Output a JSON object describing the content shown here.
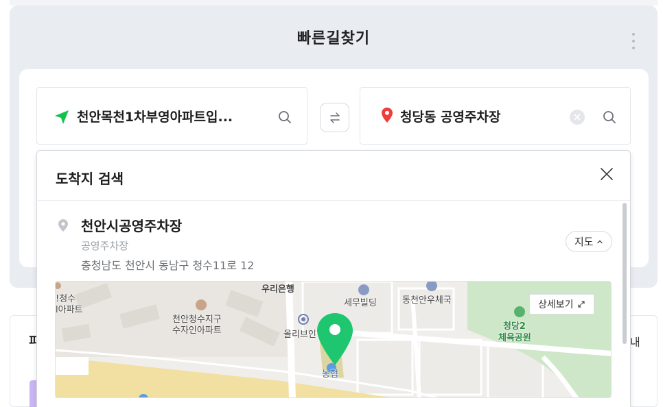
{
  "header": {
    "title": "빠른길찾기"
  },
  "origin": {
    "text": "천안목천1차부영아파트입...",
    "icon": "navigation-arrow-icon",
    "icon_color": "#11c34a"
  },
  "destination": {
    "text": "청당동 공영주차장",
    "icon": "location-pin-icon",
    "icon_color": "#f03c3c"
  },
  "swap_button": {
    "icon": "swap-arrows-icon"
  },
  "dropdown": {
    "title": "도착지 검색",
    "result": {
      "name": "천안시공영주차장",
      "category": "공영주차장",
      "address": "충청남도 천안시 동남구 청수11로 12",
      "map_toggle_label": "지도",
      "map_toggle_icon": "chevron-up-icon"
    }
  },
  "map": {
    "detail_label": "상세보기",
    "pin_color": "#1ec66f",
    "labels": {
      "woori": "우리은행",
      "semu": "세무빌딩",
      "dongcheon_post": "동천안우체국",
      "cheongsu_apt_1": "!청수",
      "cheongsu_apt_2": "l아파트",
      "district_1": "천안청수지구",
      "district_2": "수자인아파트",
      "olive": "올리브인",
      "nonghyup": "농협",
      "park_1": "청당2",
      "park_2": "체육공원"
    }
  },
  "background": {
    "left_label": "피",
    "right_label": "내"
  }
}
